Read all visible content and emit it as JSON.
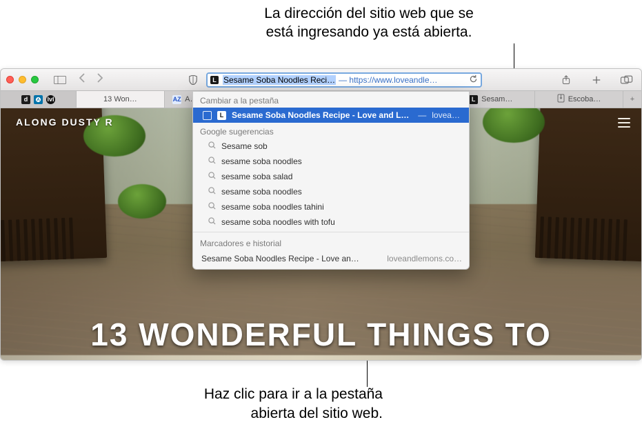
{
  "callouts": {
    "top": "La dirección del sitio web que se\nestá ingresando ya está abierta.",
    "bottom": "Haz clic para ir a la pestaña\n abierta del sitio web."
  },
  "toolbar": {
    "address_typed": "Sesame Soba Noodles Reci…",
    "address_suffix": "— https://www.loveandle…"
  },
  "tabs": {
    "group_label": "d",
    "az_label": "A…",
    "t1": "13 Won…",
    "t2": "Sesam…",
    "t3": "Escoba…"
  },
  "page": {
    "brand": "ALONG DUSTY R",
    "headline": "13 WONDERFUL THINGS TO"
  },
  "suggest": {
    "section_switch": "Cambiar a la pestaña",
    "switch_title": "Sesame Soba Noodles Recipe - Love and Lemons",
    "switch_sep": "—",
    "switch_domain": "lovean…",
    "section_google": "Google sugerencias",
    "q1": "Sesame sob",
    "q2": "sesame soba noodles",
    "q3": "sesame soba salad",
    "q4": "sesame soba noodles",
    "q5": "sesame soba noodles tahini",
    "q6": "sesame soba noodles with tofu",
    "section_history": "Marcadores e historial",
    "hist_title": "Sesame Soba Noodles Recipe - Love an…",
    "hist_domain": "loveandlemons.co…"
  }
}
